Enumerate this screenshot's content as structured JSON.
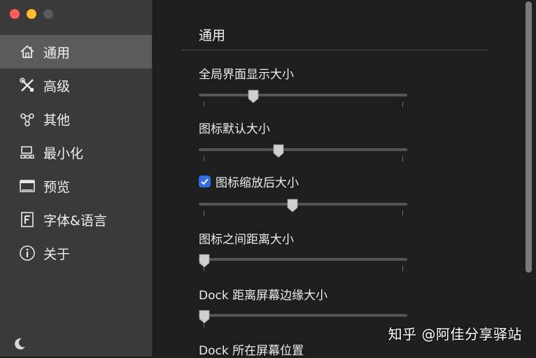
{
  "window": {
    "traffic_lights": [
      "#ff5f57",
      "#febc2e",
      "#5a5a5a"
    ]
  },
  "sidebar": {
    "items": [
      {
        "label": "通用",
        "icon": "home-icon",
        "active": true
      },
      {
        "label": "高级",
        "icon": "tools-icon",
        "active": false
      },
      {
        "label": "其他",
        "icon": "network-icon",
        "active": false
      },
      {
        "label": "最小化",
        "icon": "minimize-icon",
        "active": false
      },
      {
        "label": "预览",
        "icon": "preview-icon",
        "active": false
      },
      {
        "label": "字体&语言",
        "icon": "font-icon",
        "active": false
      },
      {
        "label": "关于",
        "icon": "info-icon",
        "active": false
      }
    ],
    "footer_icon": "moon-icon"
  },
  "main": {
    "section_title": "通用",
    "settings": [
      {
        "label": "全局界面显示大小",
        "slider": 0.26,
        "has_checkbox": false
      },
      {
        "label": "图标默认大小",
        "slider": 0.38,
        "has_checkbox": false
      },
      {
        "label": "图标缩放后大小",
        "slider": 0.45,
        "has_checkbox": true,
        "checked": true
      },
      {
        "label": "图标之间距离大小",
        "slider": 0.0,
        "has_checkbox": false
      },
      {
        "label": "Dock 距离屏幕边缘大小",
        "slider": 0.0,
        "has_checkbox": false
      },
      {
        "label": "Dock 所在屏幕位置",
        "slider": null,
        "has_checkbox": false
      }
    ]
  },
  "watermark": "知乎 @阿佳分享驿站",
  "colors": {
    "accent": "#2f6de1",
    "sidebar_bg": "#3a3a3a",
    "active_item": "#5b5b5b"
  }
}
